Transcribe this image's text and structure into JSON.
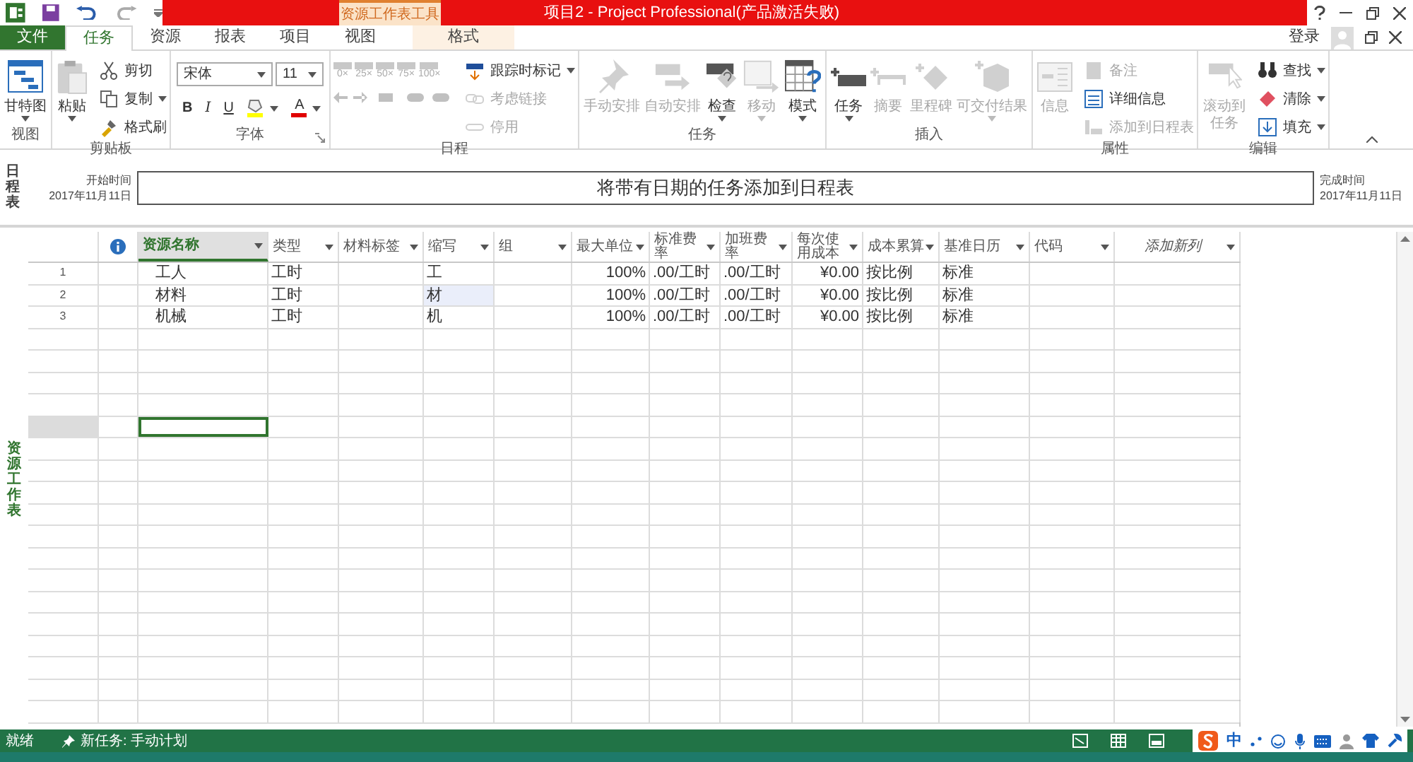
{
  "window": {
    "title": "项目2 -  Project Professional(产品激活失败)",
    "tool_context": "资源工作表工具",
    "sign_in": "登录"
  },
  "tabs": [
    {
      "label": "文件",
      "kind": "file",
      "selected": false
    },
    {
      "label": "任务",
      "kind": "tab",
      "selected": true
    },
    {
      "label": "资源",
      "kind": "tab",
      "selected": false
    },
    {
      "label": "报表",
      "kind": "tab",
      "selected": false
    },
    {
      "label": "项目",
      "kind": "tab",
      "selected": false
    },
    {
      "label": "视图",
      "kind": "tab",
      "selected": false
    },
    {
      "label": "格式",
      "kind": "tool",
      "selected": false
    }
  ],
  "ribbon": [
    {
      "label": "视图",
      "items": [
        {
          "label": "甘特图",
          "kind": "large",
          "disabled": false,
          "dropdown": true
        }
      ]
    },
    {
      "label": "剪贴板",
      "items": [
        {
          "label": "粘贴",
          "kind": "large",
          "disabled": false,
          "dropdown": true
        },
        {
          "label": "剪切",
          "kind": "small",
          "disabled": false,
          "dropdown": false
        },
        {
          "label": "复制",
          "kind": "small",
          "disabled": false,
          "dropdown": true
        },
        {
          "label": "格式刷",
          "kind": "small",
          "disabled": false,
          "dropdown": false
        }
      ]
    },
    {
      "label": "字体",
      "launcher": true,
      "items": [
        {
          "label": "宋体",
          "kind": "font_name"
        },
        {
          "label": "11",
          "kind": "font_size"
        },
        {
          "label": "B",
          "kind": "bold"
        },
        {
          "label": "I",
          "kind": "italic"
        },
        {
          "label": "U",
          "kind": "underline"
        },
        {
          "kind": "fill",
          "color": "#ffff00"
        },
        {
          "label": "A",
          "kind": "font_color",
          "color": "#e00000"
        }
      ]
    },
    {
      "label": "日程",
      "items": [
        {
          "label": "0×",
          "kind": "pct",
          "disabled": true
        },
        {
          "label": "25×",
          "kind": "pct",
          "disabled": true
        },
        {
          "label": "50×",
          "kind": "pct",
          "disabled": true
        },
        {
          "label": "75×",
          "kind": "pct",
          "disabled": true
        },
        {
          "label": "100×",
          "kind": "pct",
          "disabled": true
        },
        {
          "label": "跟踪时标记",
          "kind": "small",
          "disabled": false,
          "dropdown": true
        },
        {
          "label": "考虑链接",
          "kind": "small",
          "disabled": true,
          "dropdown": false
        },
        {
          "label": "停用",
          "kind": "small",
          "disabled": true,
          "dropdown": false
        }
      ]
    },
    {
      "label": "任务",
      "items": [
        {
          "label": "手动安排",
          "kind": "large",
          "disabled": true,
          "dropdown": false
        },
        {
          "label": "自动安排",
          "kind": "large",
          "disabled": true,
          "dropdown": false
        },
        {
          "label": "检查",
          "kind": "large",
          "disabled": false,
          "dropdown": true
        },
        {
          "label": "移动",
          "kind": "large",
          "disabled": true,
          "dropdown": true
        },
        {
          "label": "模式",
          "kind": "large",
          "disabled": false,
          "dropdown": true
        }
      ]
    },
    {
      "label": "插入",
      "items": [
        {
          "label": "任务",
          "kind": "large",
          "disabled": false,
          "dropdown": true
        },
        {
          "label": "摘要",
          "kind": "large",
          "disabled": true,
          "dropdown": false
        },
        {
          "label": "里程碑",
          "kind": "large",
          "disabled": true,
          "dropdown": false
        },
        {
          "label": "可交付结果",
          "kind": "large",
          "disabled": true,
          "dropdown": true
        }
      ]
    },
    {
      "label": "属性",
      "items": [
        {
          "label": "信息",
          "kind": "large",
          "disabled": true,
          "dropdown": false
        },
        {
          "label": "备注",
          "kind": "small",
          "disabled": true,
          "dropdown": false
        },
        {
          "label": "详细信息",
          "kind": "small",
          "disabled": false,
          "dropdown": false
        },
        {
          "label": "添加到日程表",
          "kind": "small",
          "disabled": true,
          "dropdown": false
        }
      ]
    },
    {
      "label": "编辑",
      "items": [
        {
          "label": "滚动到任务",
          "kind": "large_narrow",
          "disabled": true,
          "dropdown": false
        },
        {
          "label": "查找",
          "kind": "small",
          "disabled": false,
          "dropdown": true
        },
        {
          "label": "清除",
          "kind": "small",
          "disabled": false,
          "dropdown": true
        },
        {
          "label": "填充",
          "kind": "small",
          "disabled": false,
          "dropdown": true
        }
      ]
    }
  ],
  "timeline": {
    "side_label": "日程表",
    "start_label": "开始时间",
    "start_date": "2017年11月11日",
    "placeholder": "将带有日期的任务添加到日程表",
    "finish_label": "完成时间",
    "finish_date": "2017年11月11日"
  },
  "sheet": {
    "side_label": "资源工作表",
    "columns": [
      {
        "kind": "info",
        "selected": false
      },
      {
        "label": "资源名称",
        "kind": "field",
        "selected": true
      },
      {
        "label": "类型",
        "kind": "field",
        "selected": false
      },
      {
        "label": "材料标签",
        "kind": "field",
        "selected": false
      },
      {
        "label": "缩写",
        "kind": "field",
        "selected": false
      },
      {
        "label": "组",
        "kind": "field",
        "selected": false
      },
      {
        "label": "最大单位",
        "kind": "field",
        "selected": false
      },
      {
        "label": "标准费率",
        "kind": "field",
        "selected": false
      },
      {
        "label": "加班费率",
        "kind": "field",
        "selected": false
      },
      {
        "label": "每次使用成本",
        "kind": "field",
        "selected": false
      },
      {
        "label": "成本累算",
        "kind": "field",
        "selected": false
      },
      {
        "label": "基准日历",
        "kind": "field",
        "selected": false
      },
      {
        "label": "代码",
        "kind": "field",
        "selected": false
      },
      {
        "label": "添加新列",
        "kind": "add",
        "selected": false
      }
    ],
    "rows": [
      {
        "id": "1",
        "cells": [
          null,
          "工人",
          "工时",
          null,
          "工",
          null,
          "100%",
          ".00/工时",
          ".00/工时",
          "¥0.00",
          "按比例",
          "标准",
          null,
          null
        ],
        "abbreviation_highlighted": false
      },
      {
        "id": "2",
        "cells": [
          null,
          "材料",
          "工时",
          null,
          "材",
          null,
          "100%",
          ".00/工时",
          ".00/工时",
          "¥0.00",
          "按比例",
          "标准",
          null,
          null
        ],
        "abbreviation_highlighted": true
      },
      {
        "id": "3",
        "cells": [
          null,
          "机械",
          "工时",
          null,
          "机",
          null,
          "100%",
          ".00/工时",
          ".00/工时",
          "¥0.00",
          "按比例",
          "标准",
          null,
          null
        ],
        "abbreviation_highlighted": false
      }
    ],
    "blank_rows": [
      {
        "selected": false
      },
      {
        "selected": false
      },
      {
        "selected": false
      },
      {
        "selected": false
      },
      {
        "selected": true
      },
      {
        "selected": false
      },
      {
        "selected": false
      },
      {
        "selected": false
      },
      {
        "selected": false
      },
      {
        "selected": false
      },
      {
        "selected": false
      },
      {
        "selected": false
      },
      {
        "selected": false
      },
      {
        "selected": false
      },
      {
        "selected": false
      },
      {
        "selected": false
      },
      {
        "selected": false
      },
      {
        "selected": false
      }
    ]
  },
  "status_bar": {
    "ready": "就绪",
    "new_task": "新任务: 手动计划",
    "ime": "中"
  }
}
